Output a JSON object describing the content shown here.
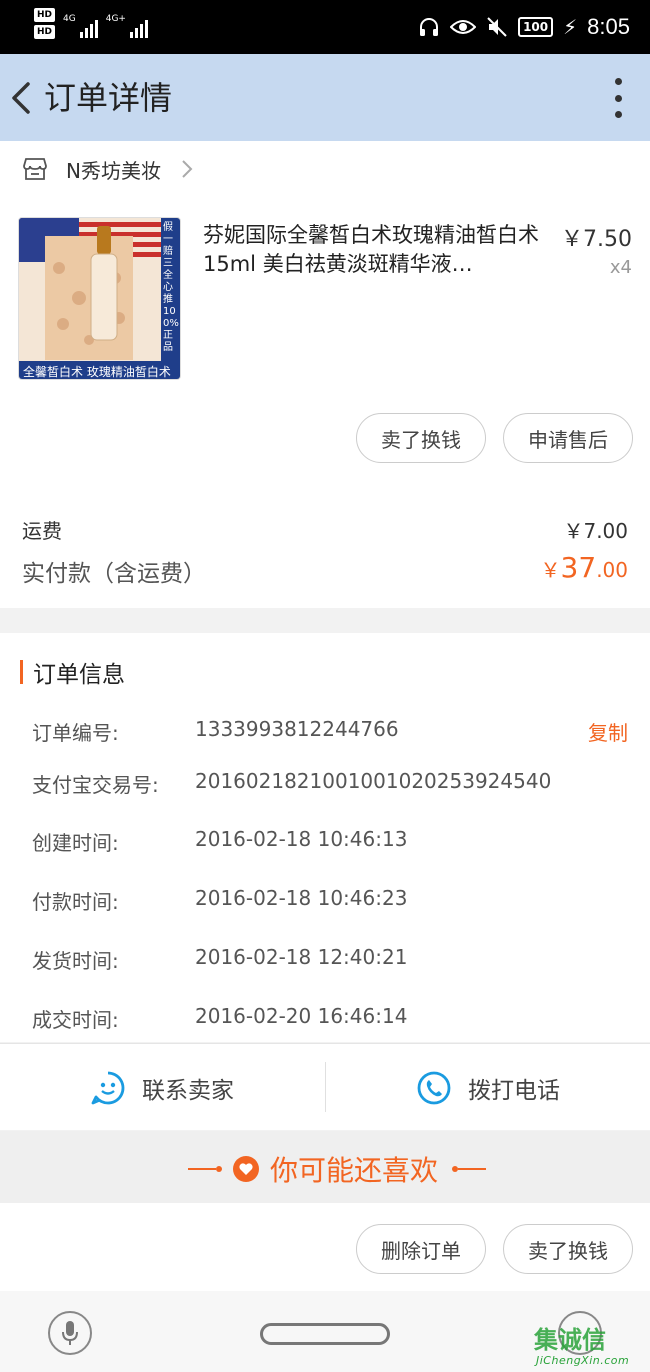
{
  "status_bar": {
    "hd1": "HD",
    "hd2": "HD",
    "net1": "4G",
    "net2": "4G+",
    "battery": "100",
    "time": "8:05"
  },
  "header": {
    "title": "订单详情"
  },
  "shop": {
    "name": "N秀坊美妆"
  },
  "product": {
    "name": "芬妮国际全馨皙白术玫瑰精油皙白术15ml 美白祛黄淡斑精华液…",
    "price": "￥7.50",
    "quantity": "x4",
    "image_caption": "全馨皙白术 玫瑰精油皙白术",
    "image_side_text": "假一赔三 全心推100%正品"
  },
  "item_actions": {
    "sell": "卖了换钱",
    "after_sale": "申请售后"
  },
  "fees": {
    "shipping_label": "运费",
    "shipping_value": "￥7.00",
    "paid_label": "实付款（含运费）",
    "paid_currency": "￥",
    "paid_integer": "37",
    "paid_decimal": ".00"
  },
  "order_info": {
    "title": "订单信息",
    "copy_label": "复制",
    "rows": [
      {
        "label": "订单编号:",
        "value": "1333993812244766"
      },
      {
        "label": "支付宝交易号:",
        "value": "2016021821001001020253924540"
      },
      {
        "label": "创建时间:",
        "value": "2016-02-18 10:46:13"
      },
      {
        "label": "付款时间:",
        "value": "2016-02-18 10:46:23"
      },
      {
        "label": "发货时间:",
        "value": "2016-02-18 12:40:21"
      },
      {
        "label": "成交时间:",
        "value": "2016-02-20 16:46:14"
      }
    ]
  },
  "contact": {
    "seller": "联系卖家",
    "phone": "拨打电话"
  },
  "recommend": {
    "label": "你可能还喜欢"
  },
  "bottom_actions": {
    "delete": "删除订单",
    "sell": "卖了换钱"
  },
  "watermark": {
    "text": "集诚信",
    "sub": "JiChengXin.com"
  },
  "colors": {
    "accent": "#f26522",
    "header_bg": "#c6d9f0",
    "contact_icon": "#1a9be0"
  }
}
